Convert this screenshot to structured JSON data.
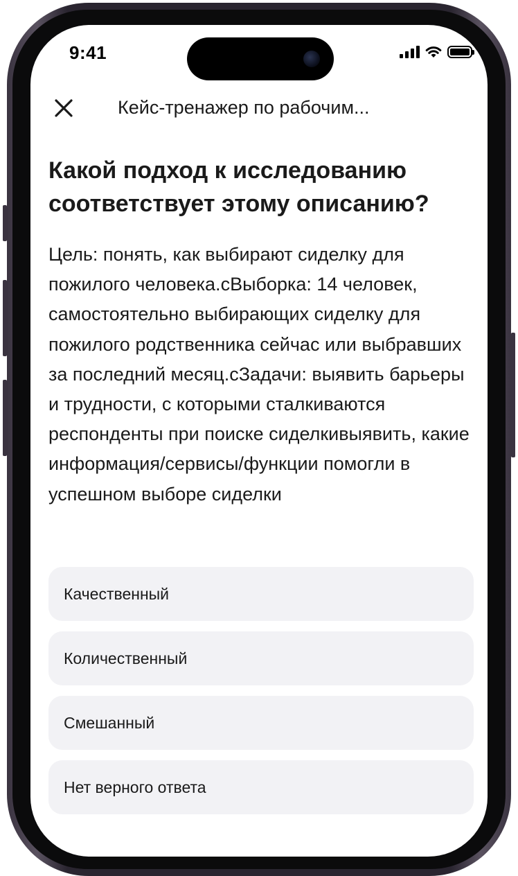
{
  "status_bar": {
    "time": "9:41"
  },
  "header": {
    "close_icon": "close-icon",
    "title": "Кейс-тренажер по рабочим..."
  },
  "question": {
    "title": "Какой подход к исследованию соответствует этому описанию?",
    "body": "Цель: понять, как выбирают сиделку для пожилого человека.сВыборка:  14 человек, самостоятельно выбирающих сиделку для пожилого родственника сейчас или выбравших за последний месяц.сЗадачи: выявить барьеры и трудности, с которыми сталкиваются респонденты при поиске сиделкивыявить, какие информация/сервисы/функции помогли в успешном выборе сиделки"
  },
  "options": [
    {
      "label": "Качественный"
    },
    {
      "label": "Количественный"
    },
    {
      "label": "Смешанный"
    },
    {
      "label": "Нет верного ответа"
    }
  ],
  "colors": {
    "option_background": "#f2f2f5",
    "text": "#1a1a1a",
    "frame": "#2a2530"
  }
}
